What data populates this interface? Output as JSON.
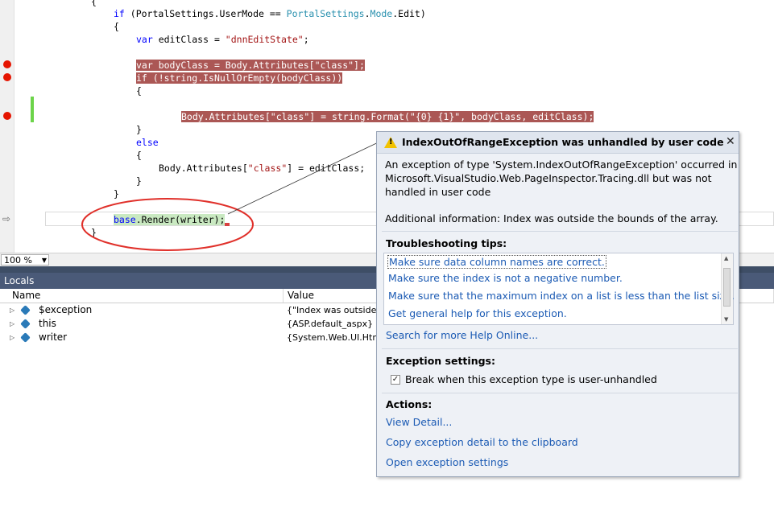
{
  "editor": {
    "lines": {
      "l0": "{",
      "l1a": "if",
      "l1b": " (PortalSettings.UserMode == ",
      "l1c": "PortalSettings",
      "l1d": ".",
      "l1e": "Mode",
      "l1f": ".Edit)",
      "l2": "{",
      "l3a": "var",
      "l3b": " editClass = ",
      "l3c": "\"dnnEditState\"",
      "l3d": ";",
      "l4a": "var",
      "l4b": " bodyClass = Body.Attributes[",
      "l4c": "\"class\"",
      "l4d": "];",
      "l5a": "if",
      "l5b": " (!",
      "l5c": "string",
      "l5d": ".IsNullOrEmpty(bodyClass))",
      "l6": "{",
      "l7a": "Body.Attributes[",
      "l7b": "\"class\"",
      "l7c": "] = ",
      "l7d": "string",
      "l7e": ".Format(",
      "l7f": "\"{0} {1}\"",
      "l7g": ", bodyClass, editClass);",
      "l8": "}",
      "l9": "else",
      "l10": "{",
      "l11a": "Body.Attributes[",
      "l11b": "\"class\"",
      "l11c": "] = editClass;",
      "l12": "}",
      "l13": "}",
      "l14a": "base",
      "l14b": ".Render(writer);",
      "l15": "}"
    }
  },
  "zoom": {
    "value": "100 %"
  },
  "locals": {
    "title": "Locals",
    "columns": [
      "Name",
      "Value"
    ],
    "rows": [
      {
        "name": "$exception",
        "value": "{\"Index was outside th"
      },
      {
        "name": "this",
        "value": "{ASP.default_aspx}"
      },
      {
        "name": "writer",
        "value": "{System.Web.UI.Htm"
      }
    ]
  },
  "popup": {
    "title": "IndexOutOfRangeException was unhandled by user code",
    "desc1": "An exception of type 'System.IndexOutOfRangeException' occurred in",
    "desc2": "Microsoft.VisualStudio.Web.PageInspector.Tracing.dll but was not",
    "desc3": "handled in user code",
    "additional": "Additional information: Index was outside the bounds of the array.",
    "tips_header": "Troubleshooting tips:",
    "tips": [
      "Make sure data column names are correct.",
      "Make sure the index is not a negative number.",
      "Make sure that the maximum index on a list is less than the list size.",
      "Get general help for this exception."
    ],
    "search_link": "Search for more Help Online...",
    "settings_header": "Exception settings:",
    "break_checkbox": "Break when this exception type is user-unhandled",
    "break_checked": true,
    "actions_header": "Actions:",
    "actions": [
      "View Detail...",
      "Copy exception detail to the clipboard",
      "Open exception settings"
    ]
  },
  "colors": {
    "breakpoint": "#e51400",
    "breakpoint_highlight": "#ab5755",
    "current_statement": "#c9e9c1",
    "annotation_circle": "#e0302a",
    "link": "#1c5bb4"
  }
}
